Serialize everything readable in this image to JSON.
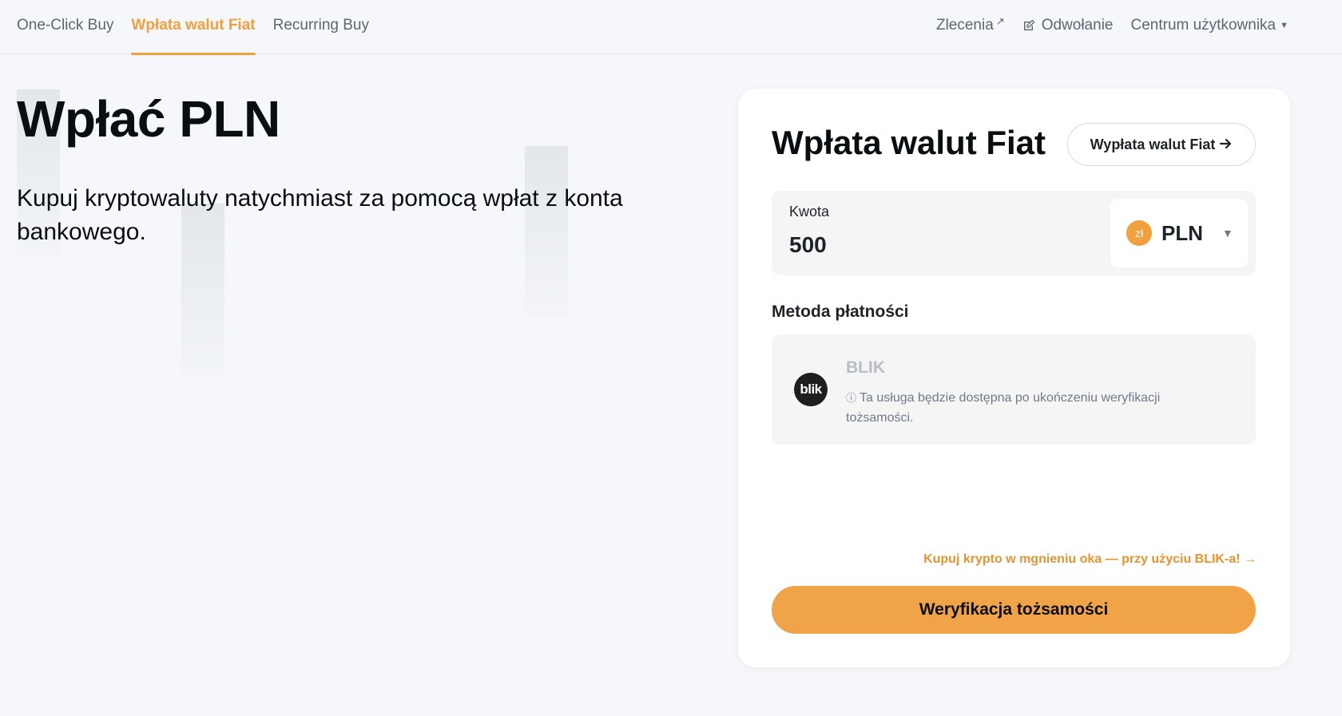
{
  "tabs": [
    {
      "label": "One-Click Buy",
      "active": false
    },
    {
      "label": "Wpłata walut Fiat",
      "active": true
    },
    {
      "label": "Recurring Buy",
      "active": false
    }
  ],
  "topnav": {
    "orders": "Zlecenia",
    "orders_icon": "external-link-icon",
    "appeal": "Odwołanie",
    "appeal_icon": "edit-icon",
    "user_center": "Centrum użytkownika",
    "user_center_icon": "caret-down-icon"
  },
  "hero": {
    "title": "Wpłać PLN",
    "subtitle": "Kupuj kryptowaluty natychmiast za pomocą wpłat z konta bankowego."
  },
  "card": {
    "title": "Wpłata walut Fiat",
    "withdraw_button": "Wypłata walut Fiat",
    "amount_label": "Kwota",
    "amount_value": "500",
    "currency_code": "PLN",
    "currency_symbol": "zł",
    "payment_method_label": "Metoda płatności",
    "method": {
      "name": "BLIK",
      "logo_text": "blik",
      "note": "Ta usługa będzie dostępna po ukończeniu weryfikacji tożsamości."
    },
    "promo_link": "Kupuj krypto w mgnieniu oka — przy użyciu BLIK-a!",
    "verify_button": "Weryfikacja tożsamości"
  },
  "colors": {
    "accent": "#f0a03c",
    "button": "#f0a347",
    "background": "#f5f7fa"
  }
}
